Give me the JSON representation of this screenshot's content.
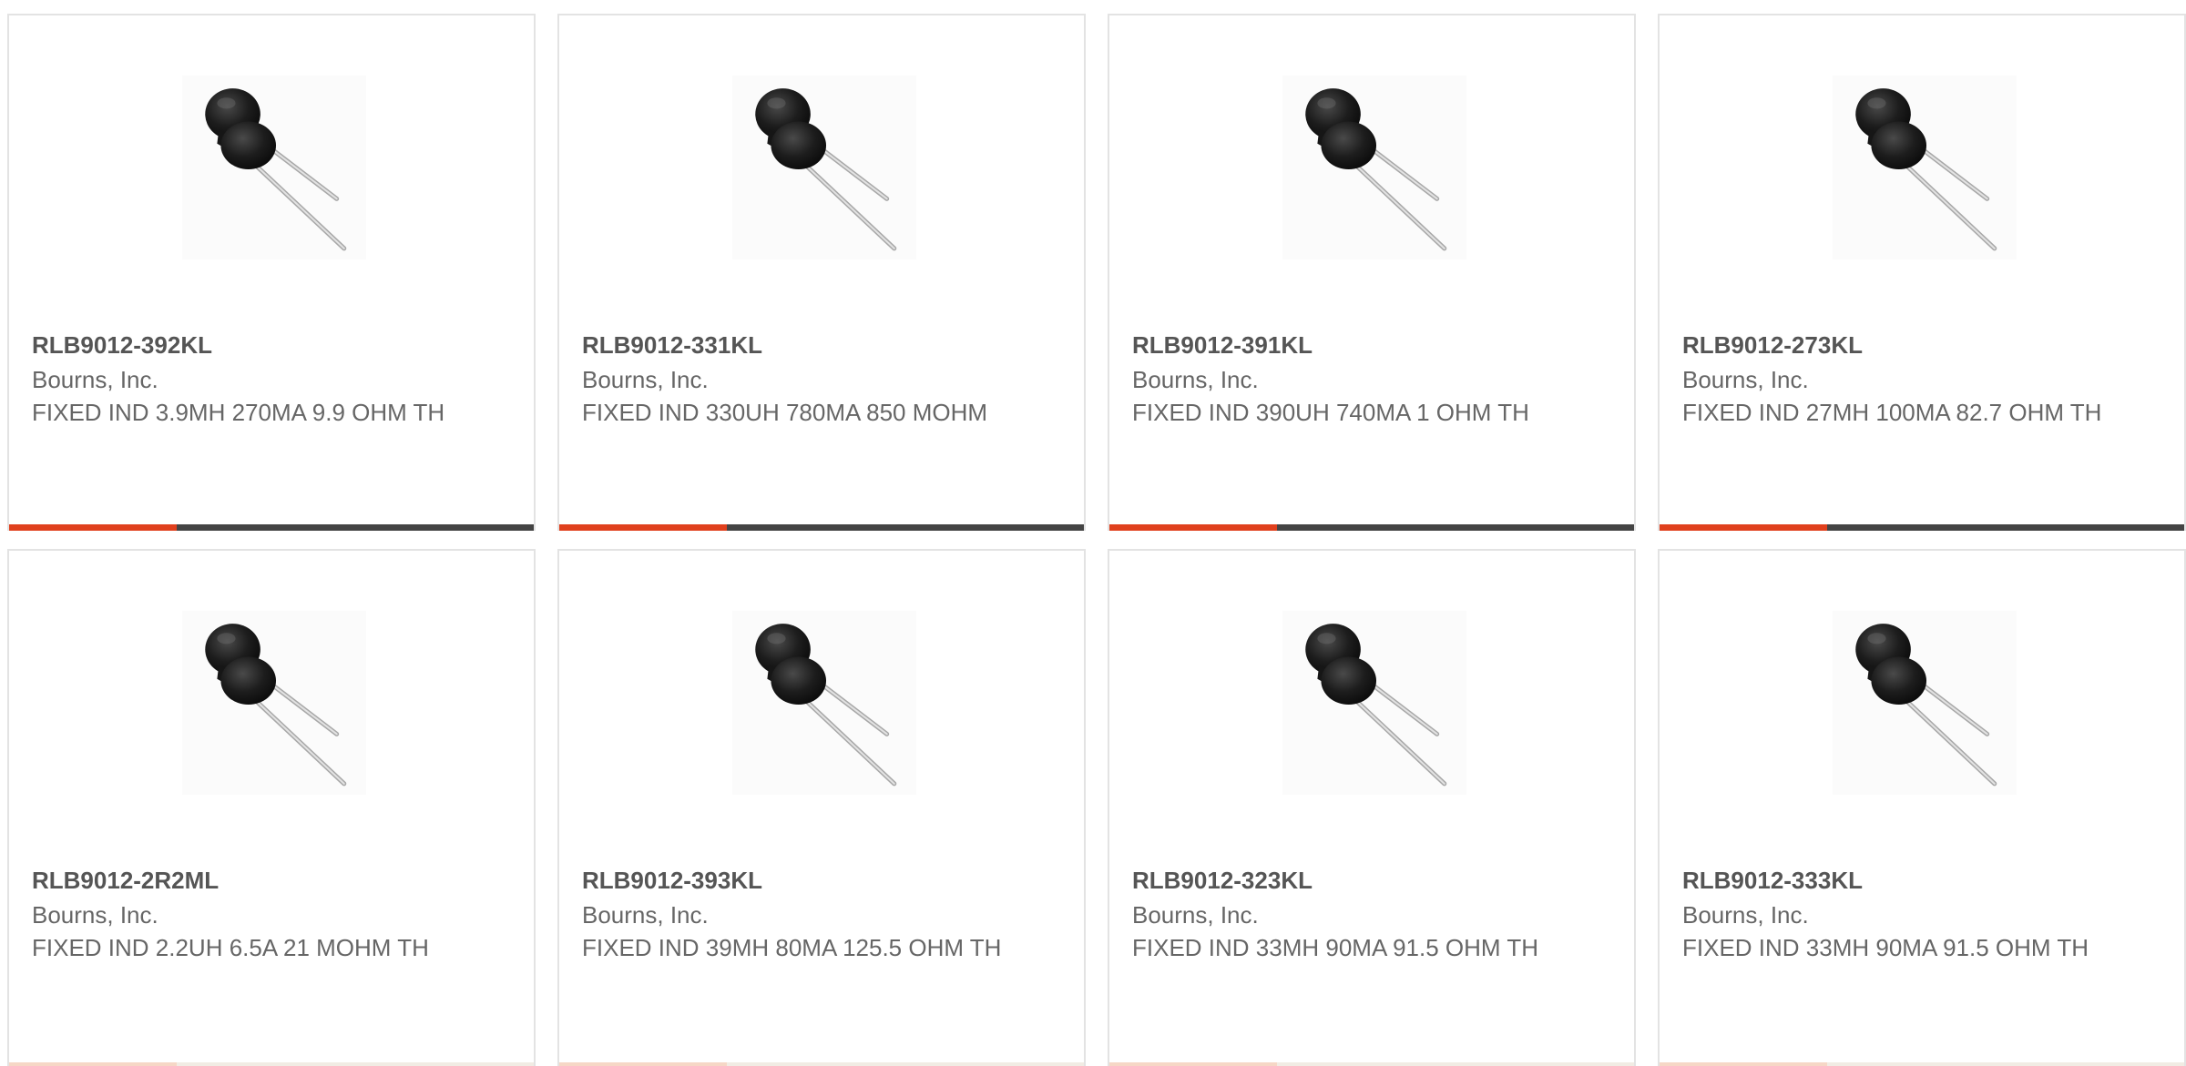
{
  "colors": {
    "accent": "#e0401d",
    "bar_track": "#444444",
    "text": "#666666",
    "border": "#e3e3e3"
  },
  "products": [
    {
      "part": "RLB9012-392KL",
      "manufacturer": "Bourns, Inc.",
      "description": "FIXED IND 3.9MH 270MA 9.9 OHM TH",
      "image_icon": "radial-inductor-icon",
      "progress": 0.32
    },
    {
      "part": "RLB9012-331KL",
      "manufacturer": "Bourns, Inc.",
      "description": "FIXED IND 330UH 780MA 850 MOHM",
      "image_icon": "radial-inductor-icon",
      "progress": 0.32
    },
    {
      "part": "RLB9012-391KL",
      "manufacturer": "Bourns, Inc.",
      "description": "FIXED IND 390UH 740MA 1 OHM TH",
      "image_icon": "radial-inductor-icon",
      "progress": 0.32
    },
    {
      "part": "RLB9012-273KL",
      "manufacturer": "Bourns, Inc.",
      "description": "FIXED IND 27MH 100MA 82.7 OHM TH",
      "image_icon": "radial-inductor-icon",
      "progress": 0.32
    },
    {
      "part": "RLB9012-2R2ML",
      "manufacturer": "Bourns, Inc.",
      "description": "FIXED IND 2.2UH 6.5A 21 MOHM TH",
      "image_icon": "radial-inductor-icon",
      "progress": 0.32
    },
    {
      "part": "RLB9012-393KL",
      "manufacturer": "Bourns, Inc.",
      "description": "FIXED IND 39MH 80MA 125.5 OHM TH",
      "image_icon": "radial-inductor-icon",
      "progress": 0.32
    },
    {
      "part": "RLB9012-323KL",
      "manufacturer": "Bourns, Inc.",
      "description": "FIXED IND 33MH 90MA 91.5 OHM TH",
      "image_icon": "radial-inductor-icon",
      "progress": 0.32
    },
    {
      "part": "RLB9012-333KL",
      "manufacturer": "Bourns, Inc.",
      "description": "FIXED IND 33MH 90MA 91.5 OHM TH",
      "image_icon": "radial-inductor-icon",
      "progress": 0.32
    }
  ]
}
